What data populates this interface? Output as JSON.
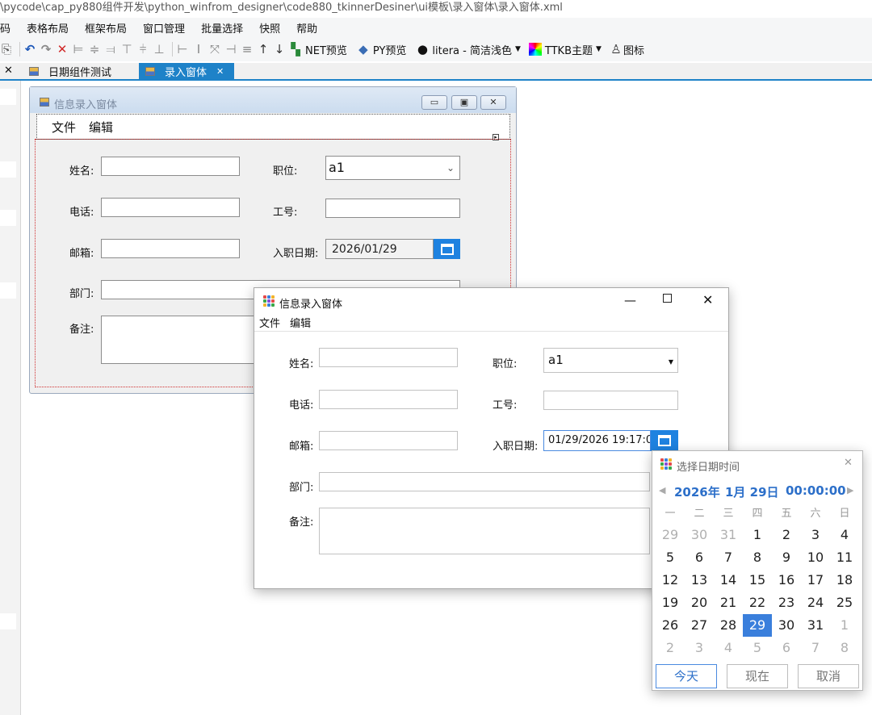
{
  "app": {
    "path": "\\pycode\\cap_py880组件开发\\python_winfrom_designer\\code880_tkinnerDesiner\\ui模板\\录入窗体\\录入窗体.xml"
  },
  "menubar": {
    "items": [
      "码",
      "表格布局",
      "框架布局",
      "窗口管理",
      "批量选择",
      "快照",
      "帮助"
    ]
  },
  "toolbar": {
    "net_preview": "NET预览",
    "py_preview": "PY预览",
    "theme_select": "litera - 简洁浅色",
    "ttkb_theme": "TTKB主题",
    "icon_label": "图标"
  },
  "tabs": {
    "close_glyph": "✕",
    "items": [
      {
        "label": "日期组件测试"
      },
      {
        "label": "录入窗体"
      }
    ]
  },
  "designer_form": {
    "title": "信息录入窗体",
    "menu": [
      "文件",
      "编辑"
    ],
    "fields": {
      "name_label": "姓名:",
      "position_label": "职位:",
      "position_value": "a1",
      "phone_label": "电话:",
      "job_no_label": "工号:",
      "email_label": "邮箱:",
      "hire_date_label": "入职日期:",
      "hire_date_value": "2026/01/29",
      "dept_label": "部门:",
      "notes_label": "备注:"
    }
  },
  "runtime_window": {
    "title": "信息录入窗体",
    "menu": [
      "文件",
      "编辑"
    ],
    "fields": {
      "name_label": "姓名:",
      "position_label": "职位:",
      "position_value": "a1",
      "phone_label": "电话:",
      "job_no_label": "工号:",
      "email_label": "邮箱:",
      "hire_date_label": "入职日期:",
      "hire_date_value": "01/29/2026 19:17:0",
      "dept_label": "部门:",
      "notes_label": "备注:"
    }
  },
  "datetime_picker": {
    "title": "选择日期时间",
    "year_label": "2026年",
    "month_day_label": "1月 29日",
    "time_label": "00:00:00",
    "weekdays": [
      "一",
      "二",
      "三",
      "四",
      "五",
      "六",
      "日"
    ],
    "weeks": [
      [
        "29",
        "30",
        "31",
        "1",
        "2",
        "3",
        "4"
      ],
      [
        "5",
        "6",
        "7",
        "8",
        "9",
        "10",
        "11"
      ],
      [
        "12",
        "13",
        "14",
        "15",
        "16",
        "17",
        "18"
      ],
      [
        "19",
        "20",
        "21",
        "22",
        "23",
        "24",
        "25"
      ],
      [
        "26",
        "27",
        "28",
        "29",
        "30",
        "31",
        "1"
      ],
      [
        "2",
        "3",
        "4",
        "5",
        "6",
        "7",
        "8"
      ]
    ],
    "selected_day": "29",
    "buttons": {
      "today": "今天",
      "now": "现在",
      "cancel": "取消"
    }
  },
  "colors": {
    "accent_blue": "#1e82c8",
    "picker_blue": "#3a7fdc",
    "invalid_red": "#d03030"
  }
}
